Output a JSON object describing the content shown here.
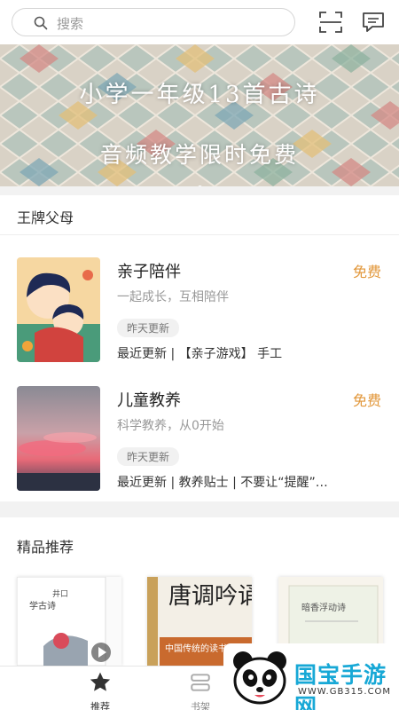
{
  "search": {
    "placeholder": "搜索"
  },
  "icons": {
    "search": "search-icon",
    "scan": "scan-icon",
    "message": "message-icon"
  },
  "banner": {
    "line1": "小学一年级13首古诗",
    "line2": "音频教学限时免费"
  },
  "section_parents": {
    "title": "王牌父母",
    "items": [
      {
        "title": "亲子陪伴",
        "price": "免费",
        "subtitle": "一起成长，互相陪伴",
        "badge": "昨天更新",
        "latest": "最近更新 | 【亲子游戏】 手工"
      },
      {
        "title": "儿童教养",
        "price": "免费",
        "subtitle": "科学教养，从0开始",
        "badge": "昨天更新",
        "latest": "最近更新 | 教养贴士 | 不要让“提醒”…"
      }
    ]
  },
  "section_recommend": {
    "title": "精品推荐",
    "books": [
      {
        "title": "学古诗",
        "top_text": "井口"
      },
      {
        "title": "唐调吟诵",
        "subtitle": "中国传统的读书"
      },
      {
        "title": "暗香浮动诗"
      }
    ]
  },
  "tabs": [
    {
      "label": "推荐",
      "icon": "star-icon",
      "active": true
    },
    {
      "label": "书架",
      "icon": "bookshelf-icon",
      "active": false
    }
  ],
  "watermark": {
    "text": "国宝手游网",
    "url": "WWW.GB315.COM"
  },
  "colors": {
    "accent_price": "#e2973a",
    "watermark_blue": "#17a8d6"
  }
}
